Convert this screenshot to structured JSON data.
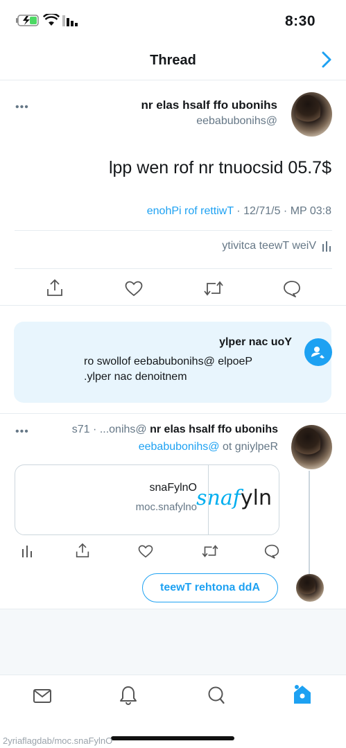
{
  "status_bar": {
    "time": "8:30"
  },
  "header": {
    "title": "Thread"
  },
  "main_tweet": {
    "display_name": "shinobu off flash sale rn",
    "handle": "@shinobubabee",
    "text": "$7.50 discount rn for new ppl",
    "time": "8:30 PM",
    "date": "5/17/21",
    "source": "Twitter for iPhone",
    "separator": "·",
    "activity_label": "View Tweet activity",
    "more_label": "•••"
  },
  "reply_notice": {
    "title": "You can reply",
    "description": "People @shinobubabee follows or mentioned can reply."
  },
  "reply_tweet": {
    "display_name": "shinobu off flash sale rn",
    "handle_truncated": "@shino...",
    "separator": "·",
    "age": "17s",
    "replying_prefix": "Replying to",
    "replying_to": "@shinobubabee",
    "more_label": "•••",
    "card": {
      "title": "OnlyFans",
      "url": "onlyfans.com",
      "logo_text": "nly",
      "logo_accent": "fans"
    }
  },
  "composer": {
    "add_button": "Add another Tweet"
  },
  "tab_bar": {
    "items": [
      "home-icon",
      "search-icon",
      "notifications-icon",
      "messages-icon"
    ],
    "active": "home-icon"
  },
  "watermark": "OnlyFans.com/badgalfairy2",
  "colors": {
    "accent": "#1da1f2",
    "muted": "#657786",
    "notice_bg": "#e8f5fd"
  }
}
